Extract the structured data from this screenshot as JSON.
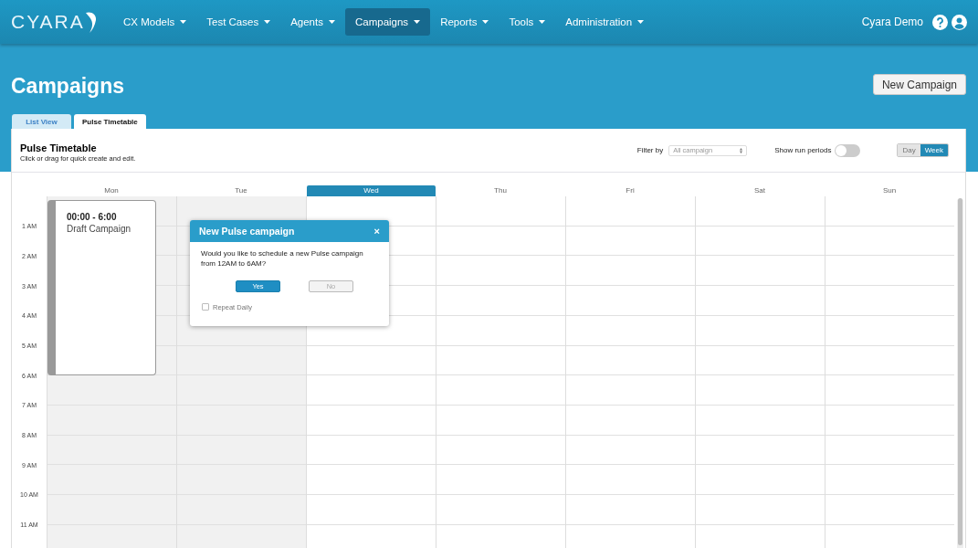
{
  "nav": {
    "logo": "CYARA",
    "items": [
      {
        "label": "CX Models",
        "selected": false
      },
      {
        "label": "Test Cases",
        "selected": false
      },
      {
        "label": "Agents",
        "selected": false
      },
      {
        "label": "Campaigns",
        "selected": true
      },
      {
        "label": "Reports",
        "selected": false
      },
      {
        "label": "Tools",
        "selected": false
      },
      {
        "label": "Administration",
        "selected": false
      }
    ],
    "user": "Cyara Demo"
  },
  "page": {
    "title": "Campaigns",
    "new_button": "New Campaign"
  },
  "tabs": [
    {
      "label": "List View",
      "selected": false
    },
    {
      "label": "Pulse Timetable",
      "selected": true
    }
  ],
  "timetable": {
    "title": "Pulse Timetable",
    "subtitle": "Click or drag for quick create and edit.",
    "filter_label": "Filter by",
    "filter": {
      "value": "All campaign"
    },
    "run_periods": {
      "label": "Show run periods",
      "on": false
    },
    "views": [
      {
        "label": "Day",
        "selected": false
      },
      {
        "label": "Week",
        "selected": true
      }
    ],
    "days": [
      {
        "label": "Mon",
        "past": true,
        "selected": false,
        "events": [
          {
            "time": "00:00 - 6:00",
            "title": "Draft Campaign"
          }
        ]
      },
      {
        "label": "Tue",
        "past": true,
        "selected": false
      },
      {
        "label": "Wed",
        "past": false,
        "selected": true
      },
      {
        "label": "Thu",
        "past": false,
        "selected": false
      },
      {
        "label": "Fri",
        "past": false,
        "selected": false
      },
      {
        "label": "Sat",
        "past": false,
        "selected": false
      },
      {
        "label": "Sun",
        "past": false,
        "selected": false
      }
    ],
    "hours": [
      "1 AM",
      "2 AM",
      "3 AM",
      "4 AM",
      "5 AM",
      "6 AM",
      "7 AM",
      "8 AM",
      "9 AM",
      "10 AM",
      "11 AM"
    ]
  },
  "dialog": {
    "title": "New Pulse campaign",
    "close": "×",
    "message": "Would you like to schedule a new Pulse campaign from 12AM to 6AM?",
    "buttons": [
      {
        "label": "Yes",
        "kind": "primary"
      },
      {
        "label": "No",
        "kind": "secondary"
      }
    ],
    "repeat": {
      "label": "Repeat Daily",
      "checked": false
    }
  }
}
